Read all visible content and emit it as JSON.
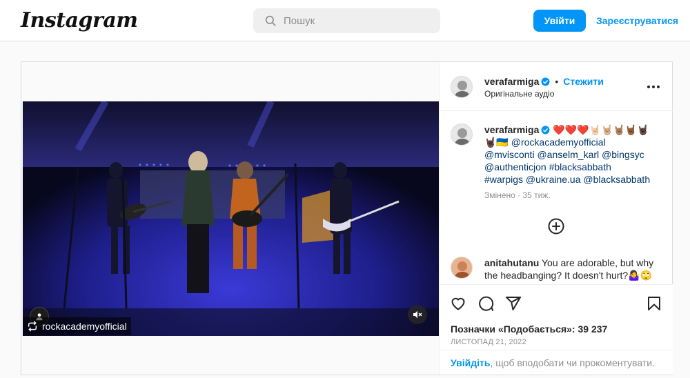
{
  "header": {
    "logo": "Instagram",
    "search_placeholder": "Пошук",
    "login_label": "Увійти",
    "signup_label": "Зареєструватися"
  },
  "post": {
    "author": "verafarmiga",
    "follow_label": "Стежити",
    "audio_label": "Оригінальне аудіо",
    "video": {
      "repost_account": "rockacademyofficial"
    },
    "caption": {
      "username": "verafarmiga",
      "emojis_line1": "❤️❤️❤️🤘🏻🤘🏼🤘🏽🤘🏾🤘🏿",
      "emojis_line2": "🤘🏿🇺🇦",
      "tags_line2": "@rockacademyofficial",
      "line3": "@mvisconti @anselm_karl @bingsyc",
      "line4": "@authenticjon #blacksabbath",
      "line5": "#warpigs @ukraine.ua @blacksabbath",
      "edited": "Змінено · 35 тиж."
    },
    "comment": {
      "username": "anitahutanu",
      "text": "You are adorable, but why the headbanging? It doesn't hurt?🤷‍♀️🙄"
    },
    "likes_text": "Позначки «Подобається»: 39 237",
    "date": "ЛИСТОПАД 21, 2022",
    "login_prompt_link": "Увійдіть",
    "login_prompt_rest": ", щоб вподобати чи прокоментувати."
  },
  "colors": {
    "accent": "#0095f6",
    "tag": "#00376b",
    "muted": "#8e8e8e"
  },
  "icons": [
    "search-icon",
    "verified-icon",
    "more-icon",
    "add-comment-icon",
    "heart-icon",
    "comment-icon",
    "share-icon",
    "bookmark-icon",
    "repost-icon",
    "mute-icon",
    "user-icon"
  ]
}
